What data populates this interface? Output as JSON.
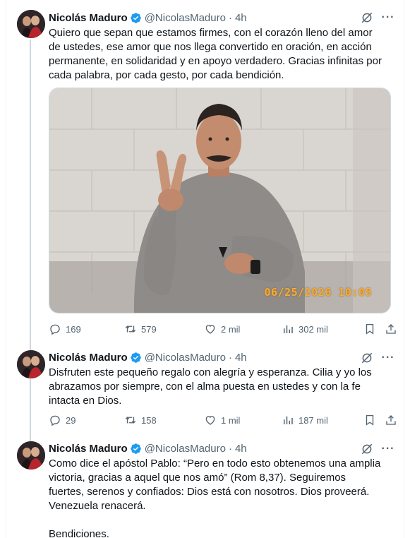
{
  "tweets": [
    {
      "name": "Nicolás Maduro",
      "handle": "@NicolasMaduro",
      "time": "4h",
      "text": "Quiero que sepan que estamos firmes, con el corazón lleno del amor de ustedes, ese amor que nos llega convertido en oración, en acción permanente, en solidaridad y en apoyo verdadero. Gracias infinitas por cada palabra, por cada gesto, por cada bendición.",
      "media_timestamp": "06/25/2026 10:05",
      "replies": "169",
      "reposts": "579",
      "likes": "2 mil",
      "views": "302 mil"
    },
    {
      "name": "Nicolás Maduro",
      "handle": "@NicolasMaduro",
      "time": "4h",
      "text": "Disfruten este pequeño regalo con alegría y esperanza. Cilia y yo los abrazamos por siempre, con el alma puesta en ustedes y con la fe intacta en Dios.",
      "replies": "29",
      "reposts": "158",
      "likes": "1 mil",
      "views": "187 mil"
    },
    {
      "name": "Nicolás Maduro",
      "handle": "@NicolasMaduro",
      "time": "4h",
      "text": "Como dice el apóstol Pablo: “Pero en todo esto obtenemos una amplia victoria, gracias a aquel que nos amó” (Rom 8,37). Seguiremos fuertes, serenos y confiados: Dios está con nosotros. Dios proveerá. Venezuela renacerá.\n\nBendiciones."
    }
  ],
  "colors": {
    "text": "#0f1419",
    "secondary": "#536471",
    "verified": "#1d9bf0",
    "thread_line": "#cfd9de",
    "media_timestamp": "#f2ad3a"
  }
}
